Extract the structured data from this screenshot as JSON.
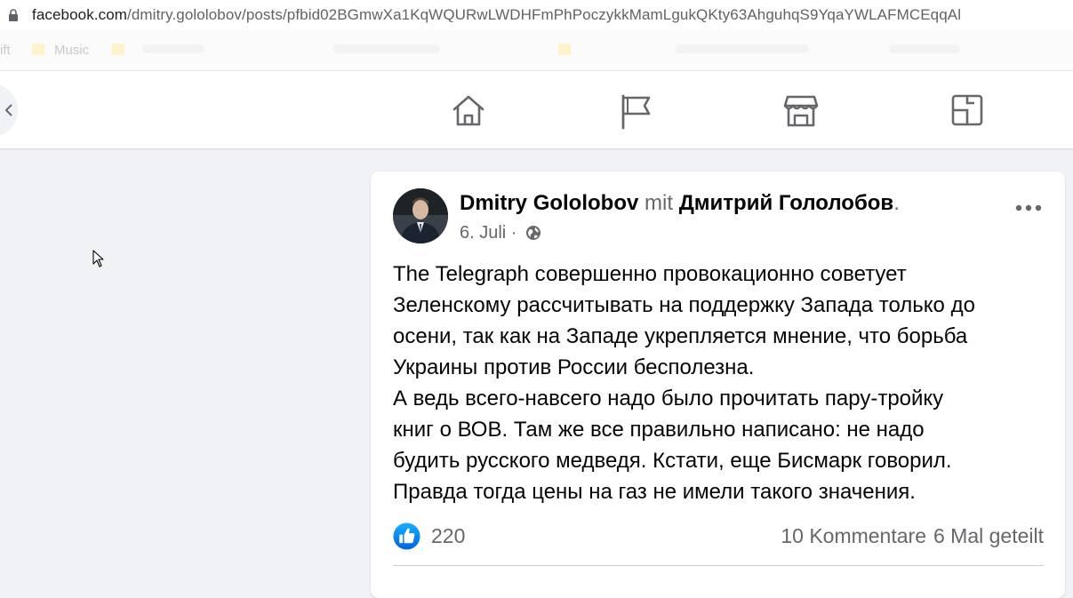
{
  "browser": {
    "url_host": "facebook.com",
    "url_path": "/dmitry.gololobov/posts/pfbid02BGmwXa1KqWQURwLWDHFmPhPoczykkMamLgukQKty63AhguhqS9YqaYWLAFMCEqqAl",
    "bookmarks": [
      "ift",
      "Music"
    ]
  },
  "nav": {
    "icons": [
      "home-icon",
      "flag-icon",
      "marketplace-icon",
      "gaming-icon"
    ]
  },
  "post": {
    "author": "Dmitry Gololobov",
    "with_word": "mit",
    "tagged": "Дмитрий Гололобов",
    "tagged_suffix": ".",
    "date": "6. Juli",
    "date_sep": " · ",
    "text_lines": [
      "The Telegraph совершенно провокационно советует",
      "Зеленскому рассчитывать на поддержку Запада только до",
      "осени, так как на Западе укрепляется мнение, что борьба",
      "Украины против России бесполезна.",
      "А ведь всего-навсего надо было прочитать пару-тройку",
      "книг о ВОВ. Там же все правильно написано: не надо",
      "будить русского медведя. Кстати, еще Бисмарк говорил.",
      "Правда тогда цены на газ не имели такого значения."
    ],
    "reactions_count": "220",
    "comments": "10 Kommentare",
    "shares": "6 Mal geteilt"
  },
  "colors": {
    "accent": "#1877f2",
    "icon_gray": "#65676b",
    "background": "#f0f2f5"
  }
}
